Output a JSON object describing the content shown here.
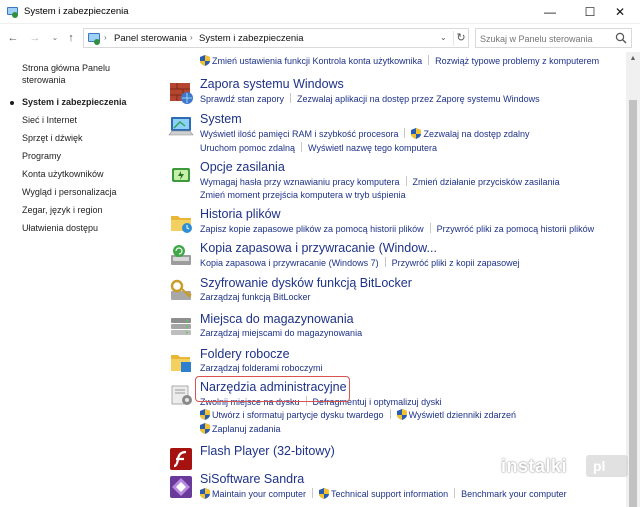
{
  "window": {
    "title": "System i zabezpieczenia",
    "minimize": "—",
    "maximize": "☐",
    "close": "✕"
  },
  "nav": {
    "back": "←",
    "forward": "→",
    "recent": "⌄",
    "up": "↑"
  },
  "address": {
    "crumbs": [
      "Panel sterowania",
      "System i zabezpieczenia"
    ],
    "separator": "›",
    "dropdown": "⌄",
    "refresh": "↻"
  },
  "search": {
    "placeholder": "Szukaj w Panelu sterowania"
  },
  "sidebar": {
    "items": [
      {
        "label": "Strona główna Panelu sterowania"
      },
      {
        "label": "System i zabezpieczenia"
      },
      {
        "label": "Sieć i Internet"
      },
      {
        "label": "Sprzęt i dźwięk"
      },
      {
        "label": "Programy"
      },
      {
        "label": "Konta użytkowników"
      },
      {
        "label": "Wygląd i personalizacja"
      },
      {
        "label": "Zegar, język i region"
      },
      {
        "label": "Ułatwienia dostępu"
      }
    ]
  },
  "categories": [
    {
      "heading": "",
      "rows": [
        [
          {
            "text": "Zmień ustawienia funkcji Kontrola konta użytkownika",
            "shield": true
          },
          {
            "text": "Rozwiąż typowe problemy z komputerem",
            "shield": false
          }
        ]
      ]
    },
    {
      "heading": "Zapora systemu Windows",
      "rows": [
        [
          {
            "text": "Sprawdź stan zapory",
            "shield": false
          },
          {
            "text": "Zezwalaj aplikacji na dostęp przez Zaporę systemu Windows",
            "shield": false
          }
        ]
      ]
    },
    {
      "heading": "System",
      "rows": [
        [
          {
            "text": "Wyświetl ilość pamięci RAM i szybkość procesora",
            "shield": false
          },
          {
            "text": "Zezwalaj na dostęp zdalny",
            "shield": true
          }
        ],
        [
          {
            "text": "Uruchom pomoc zdalną",
            "shield": false
          },
          {
            "text": "Wyświetl nazwę tego komputera",
            "shield": false
          }
        ]
      ]
    },
    {
      "heading": "Opcje zasilania",
      "rows": [
        [
          {
            "text": "Wymagaj hasła przy wznawianiu pracy komputera",
            "shield": false
          },
          {
            "text": "Zmień działanie przycisków zasilania",
            "shield": false
          }
        ],
        [
          {
            "text": "Zmień moment przejścia komputera w tryb uśpienia",
            "shield": false
          }
        ]
      ]
    },
    {
      "heading": "Historia plików",
      "rows": [
        [
          {
            "text": "Zapisz kopie zapasowe plików za pomocą historii plików",
            "shield": false
          },
          {
            "text": "Przywróć pliki za pomocą historii plików",
            "shield": false
          }
        ]
      ]
    },
    {
      "heading": "Kopia zapasowa i przywracanie (Window...",
      "rows": [
        [
          {
            "text": "Kopia zapasowa i przywracanie (Windows 7)",
            "shield": false
          },
          {
            "text": "Przywróć pliki z kopii zapasowej",
            "shield": false
          }
        ]
      ]
    },
    {
      "heading": "Szyfrowanie dysków funkcją BitLocker",
      "rows": [
        [
          {
            "text": "Zarządzaj funkcją BitLocker",
            "shield": false
          }
        ]
      ]
    },
    {
      "heading": "Miejsca do magazynowania",
      "rows": [
        [
          {
            "text": "Zarządzaj miejscami do magazynowania",
            "shield": false
          }
        ]
      ]
    },
    {
      "heading": "Foldery robocze",
      "rows": [
        [
          {
            "text": "Zarządzaj folderami roboczymi",
            "shield": false
          }
        ]
      ]
    },
    {
      "heading": "Narzędzia administracyjne",
      "rows": [
        [
          {
            "text": "Zwolnij miejsce na dysku",
            "shield": false
          },
          {
            "text": "Defragmentuj i optymalizuj dyski",
            "shield": false
          }
        ],
        [
          {
            "text": "Utwórz i sformatuj partycje dysku twardego",
            "shield": true
          },
          {
            "text": "Wyświetl dzienniki zdarzeń",
            "shield": true
          }
        ],
        [
          {
            "text": "Zaplanuj zadania",
            "shield": true
          }
        ]
      ]
    },
    {
      "heading": "Flash Player (32-bitowy)",
      "rows": []
    },
    {
      "heading": "SiSoftware Sandra",
      "rows": [
        [
          {
            "text": "Maintain your computer",
            "shield": true
          },
          {
            "text": "Technical support information",
            "shield": true
          },
          {
            "text": "Benchmark your computer",
            "shield": false
          }
        ]
      ]
    }
  ],
  "scrollbar": {
    "up": "▲"
  },
  "watermark": {
    "text": "instalki",
    "tag": "pl"
  },
  "colors": {
    "link": "#1e3287",
    "highlight": "#d9534f",
    "shield_blue": "#2a5db0",
    "shield_yellow": "#f2c230"
  }
}
